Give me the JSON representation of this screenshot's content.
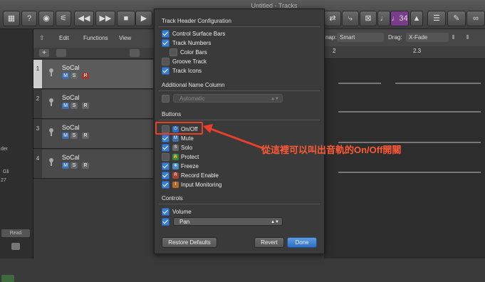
{
  "window": {
    "title": "Untitled - Tracks"
  },
  "toolbar": {
    "lcd_label": "♩34"
  },
  "inspector": {
    "texts": [
      "der",
      "Gli",
      "27",
      "Read"
    ]
  },
  "tracks_toolbar": {
    "edit": "Edit",
    "functions": "Functions",
    "view": "View"
  },
  "arrange_toolbar": {
    "snap_label": "nap:",
    "snap_value": "Smart",
    "drag_label": "Drag:",
    "drag_value": "X-Fade",
    "ruler_mark_1": "2",
    "ruler_mark_2": "2.3"
  },
  "tracks": [
    {
      "num": "1",
      "name": "SoCal",
      "m": "M",
      "s": "S",
      "r": "R"
    },
    {
      "num": "2",
      "name": "SoCal",
      "m": "M",
      "s": "S",
      "r": "R"
    },
    {
      "num": "3",
      "name": "SoCal",
      "m": "M",
      "s": "S",
      "r": "R"
    },
    {
      "num": "4",
      "name": "SoCal",
      "m": "M",
      "s": "S",
      "r": "R"
    }
  ],
  "dialog": {
    "sections": {
      "config": "Track Header Configuration",
      "additional": "Additional Name Column",
      "buttons": "Buttons",
      "controls": "Controls"
    },
    "config_items": [
      {
        "label": "Control Surface Bars",
        "checked": true
      },
      {
        "label": "Track Numbers",
        "checked": true
      },
      {
        "label": "Color Bars",
        "checked": false
      },
      {
        "label": "Groove Track",
        "checked": false
      },
      {
        "label": "Track Icons",
        "checked": true
      }
    ],
    "additional_select": "Automatic",
    "button_items": [
      {
        "label": "On/Off",
        "checked": false
      },
      {
        "label": "Mute",
        "checked": true
      },
      {
        "label": "Solo",
        "checked": true
      },
      {
        "label": "Protect",
        "checked": false
      },
      {
        "label": "Freeze",
        "checked": true
      },
      {
        "label": "Record Enable",
        "checked": true
      },
      {
        "label": "Input Monitoring",
        "checked": true
      }
    ],
    "controls": {
      "volume": "Volume",
      "pan_select": "Pan"
    },
    "restore_defaults": "Restore Defaults",
    "revert": "Revert",
    "done": "Done"
  },
  "annotation": {
    "text": "從這裡可以叫出音軌的On/Off開關",
    "color": "#ff5a36"
  }
}
